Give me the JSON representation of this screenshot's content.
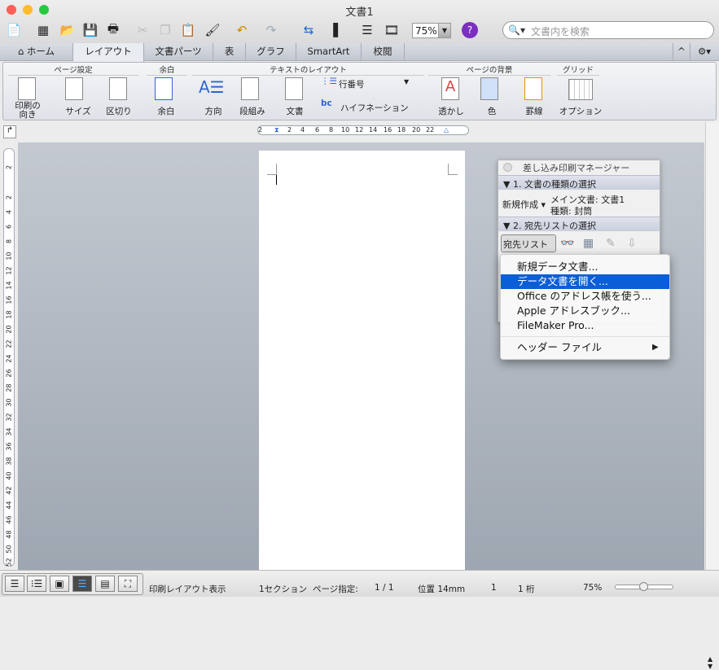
{
  "window": {
    "title": "文書1"
  },
  "toolbar": {
    "zoom": "75%",
    "search_placeholder": "文書内を検索"
  },
  "tabs": [
    "ホーム",
    "レイアウト",
    "文書パーツ",
    "表",
    "グラフ",
    "SmartArt",
    "校閲"
  ],
  "ribbon": {
    "groups": [
      "ページ設定",
      "余白",
      "テキストのレイアウト",
      "ページの背景",
      "グリッド"
    ],
    "buttons": {
      "orientation": "印刷の\n向き",
      "size": "サイズ",
      "breaks": "区切り",
      "margins": "余白",
      "direction": "方向",
      "columns": "段組み",
      "document": "文書",
      "line_numbers": "行番号",
      "hyphenation": "ハイフネーション",
      "watermark": "透かし",
      "color": "色",
      "borders": "罫線",
      "options": "オプション"
    }
  },
  "ruler": {
    "h_ticks": [
      "2",
      "2",
      "4",
      "6",
      "8",
      "10",
      "12",
      "14",
      "16",
      "18",
      "20",
      "22"
    ],
    "v_ticks": [
      "2",
      "2",
      "4",
      "6",
      "8",
      "10",
      "12",
      "14",
      "16",
      "18",
      "20",
      "22",
      "24",
      "26",
      "28",
      "30",
      "32",
      "34",
      "36",
      "38",
      "40",
      "42",
      "44",
      "46",
      "48",
      "50",
      "52"
    ]
  },
  "mail_merge": {
    "title": "差し込み印刷マネージャー",
    "section1": "1. 文書の種類の選択",
    "create_new": "新規作成",
    "main_doc": "メイン文書: 文書1",
    "doc_type": "種類: 封筒",
    "section2": "2. 宛先リストの選択",
    "recipients": "宛先リスト"
  },
  "menu": {
    "items": [
      "新規データ文書...",
      "データ文書を開く...",
      "Office のアドレス帳を使う...",
      "Apple アドレスブック...",
      "FileMaker Pro...",
      "ヘッダー ファイル"
    ],
    "selected_index": 1
  },
  "status": {
    "view": "印刷レイアウト表示",
    "section": "1セクション",
    "page_label": "ページ指定:",
    "page": "1 / 1",
    "position": "位置 14mm",
    "line": "1",
    "col": "1 桁",
    "zoom": "75%",
    "zoom_slider": 0.5
  }
}
